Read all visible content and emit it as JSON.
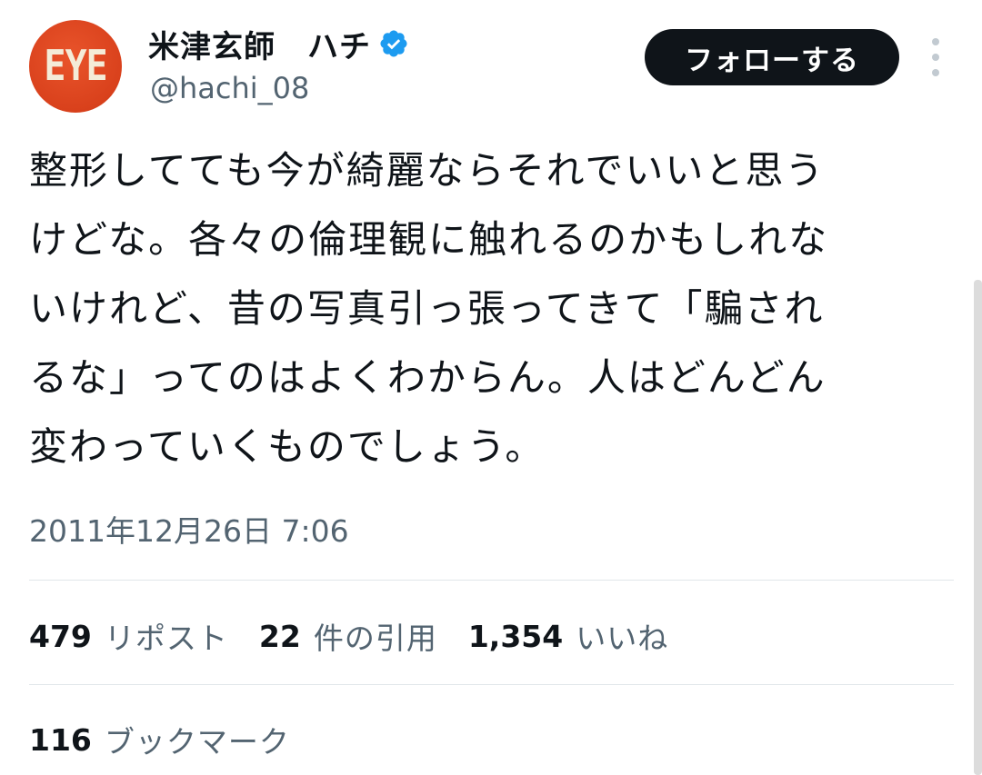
{
  "user": {
    "avatar_text": "EYE",
    "display_name": "米津玄師　ハチ",
    "handle": "@hachi_08",
    "verified_icon": "verified-badge-icon",
    "verified_color": "#1d9bf0"
  },
  "actions": {
    "follow_label": "フォローする",
    "more_icon": "more-vertical-icon"
  },
  "tweet": {
    "lines": [
      "整形してても今が綺麗ならそれでいいと思う",
      "けどな。各々の倫理観に触れるのかもしれな",
      "いけれど、昔の写真引っ張ってきて「騙され",
      "るな」ってのはよくわからん。人はどんどん",
      "変わっていくものでしょう。"
    ],
    "timestamp": "2011年12月26日 7:06"
  },
  "stats": {
    "reposts": {
      "count": "479",
      "label": "リポスト"
    },
    "quotes": {
      "count": "22",
      "label": "件の引用"
    },
    "likes": {
      "count": "1,354",
      "label": "いいね"
    },
    "bookmarks": {
      "count": "116",
      "label": "ブックマーク"
    }
  },
  "colors": {
    "text_primary": "#0f1419",
    "text_secondary": "#536471",
    "avatar_bg": "#d9411c",
    "button_bg": "#0f1419",
    "divider": "#e1e6ea"
  }
}
